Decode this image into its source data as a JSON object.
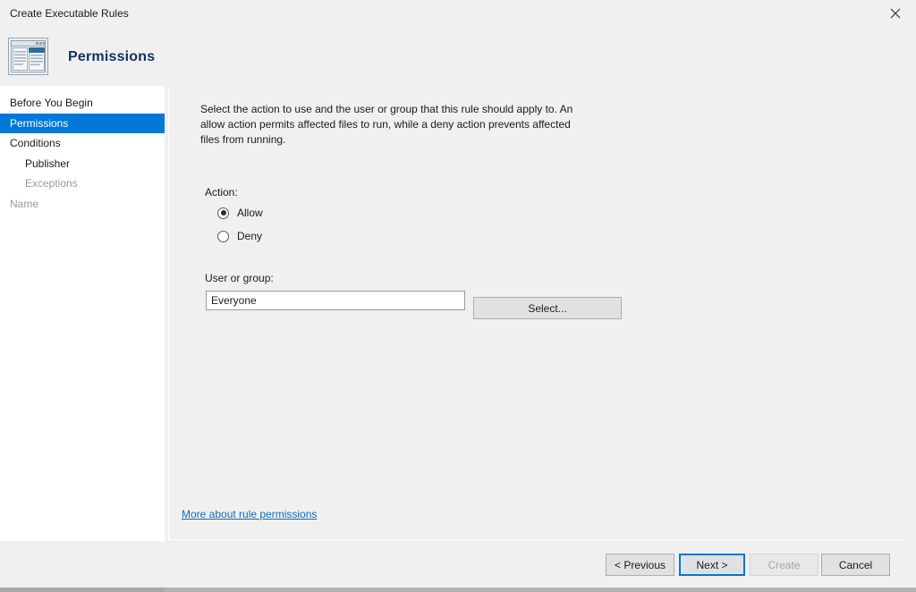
{
  "window": {
    "title": "Create Executable Rules",
    "close_icon": "close-icon"
  },
  "header": {
    "title": "Permissions",
    "icon": "wizard-window-icon"
  },
  "sidebar": {
    "items": [
      {
        "label": "Before You Begin",
        "state": "normal",
        "indent": false
      },
      {
        "label": "Permissions",
        "state": "selected",
        "indent": false
      },
      {
        "label": "Conditions",
        "state": "normal",
        "indent": false
      },
      {
        "label": "Publisher",
        "state": "normal",
        "indent": true
      },
      {
        "label": "Exceptions",
        "state": "dim",
        "indent": true
      },
      {
        "label": "Name",
        "state": "dim",
        "indent": false
      }
    ]
  },
  "main": {
    "description": "Select the action to use and the user or group that this rule should apply to. An allow action permits affected files to run, while a deny action prevents affected files from running.",
    "action_label": "Action:",
    "radios": [
      {
        "label": "Allow",
        "checked": true
      },
      {
        "label": "Deny",
        "checked": false
      }
    ],
    "user_group_label": "User or group:",
    "user_group_value": "Everyone",
    "user_group_placeholder": "",
    "select_button": "Select...",
    "help_link": "More about rule permissions"
  },
  "footer": {
    "previous": "< Previous",
    "next": "Next >",
    "create": "Create",
    "cancel": "Cancel"
  },
  "colors": {
    "accent": "#0078d7",
    "link": "#0f6cbd",
    "header_title": "#13315a",
    "disabled_text": "#a6a6a6",
    "dim_text": "#9a9a9a"
  }
}
